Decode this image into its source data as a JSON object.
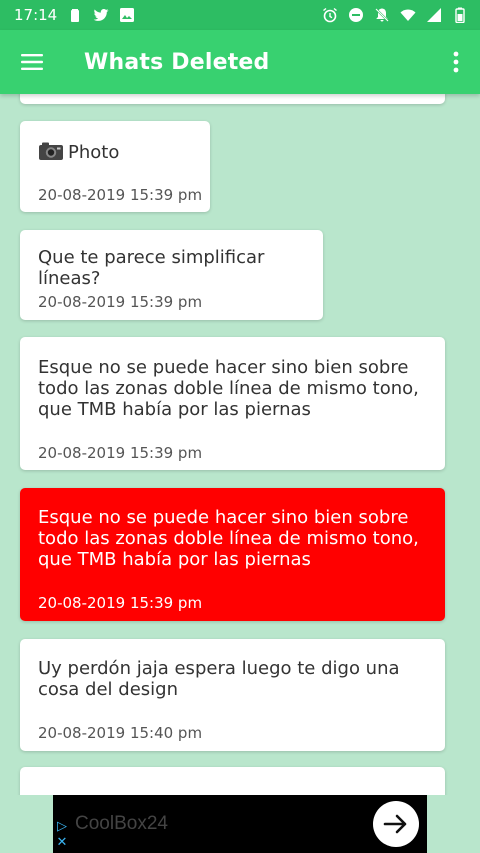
{
  "status_bar": {
    "time": "17:14",
    "left_icons": [
      "battery-saver-icon",
      "twitter-icon",
      "image-icon"
    ],
    "right_icons": [
      "alarm-icon",
      "do-not-disturb-icon",
      "notifications-off-icon",
      "wifi-icon",
      "signal-icon",
      "battery-icon"
    ]
  },
  "app_bar": {
    "title": "Whats Deleted",
    "color": "#38d170"
  },
  "messages": [
    {
      "text": "Photo",
      "time": "20-08-2019  15:39 pm",
      "type": "photo",
      "deleted": false
    },
    {
      "text": "Que te parece simplificar líneas?",
      "time": "20-08-2019  15:39 pm",
      "type": "text",
      "deleted": false
    },
    {
      "text": "Esque no se puede hacer sino bien sobre todo las zonas doble línea de mismo tono, que TMB había por las piernas",
      "time": "20-08-2019  15:39 pm",
      "type": "text",
      "deleted": false
    },
    {
      "text": "Esque no se puede hacer sino bien sobre todo las zonas doble línea de mismo tono, que TMB había por las piernas",
      "time": "20-08-2019  15:39 pm",
      "type": "text",
      "deleted": true
    },
    {
      "text": "Uy perdón jaja espera luego te digo una cosa del design",
      "time": "20-08-2019  15:40 pm",
      "type": "text",
      "deleted": false
    }
  ],
  "ad": {
    "text": "CoolBox24",
    "info_icon": "ad-choices-icon",
    "action_icon": "arrow-right-icon"
  },
  "colors": {
    "status_bar": "#2dbd63",
    "background": "#b9e6cc",
    "deleted_card": "#ff0000"
  }
}
